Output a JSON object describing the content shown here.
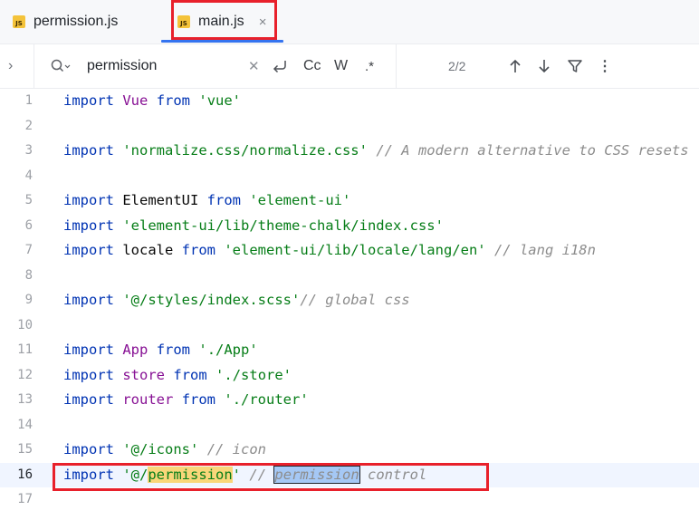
{
  "tabs": [
    {
      "label": "permission.js",
      "icon": "js-file-icon",
      "active": false
    },
    {
      "label": "main.js",
      "icon": "js-file-icon",
      "active": true,
      "close": "×"
    }
  ],
  "find": {
    "query": "permission",
    "match_count": "2/2",
    "case_label": "Cc",
    "word_label": "W",
    "regex_label": ".*"
  },
  "editor": {
    "current_line": 16,
    "lines": [
      {
        "n": "1",
        "code": "import Vue from 'vue'"
      },
      {
        "n": "2",
        "code": ""
      },
      {
        "n": "3",
        "code": "import 'normalize.css/normalize.css' // A modern alternative to CSS resets"
      },
      {
        "n": "4",
        "code": ""
      },
      {
        "n": "5",
        "code": "import ElementUI from 'element-ui'"
      },
      {
        "n": "6",
        "code": "import 'element-ui/lib/theme-chalk/index.css'"
      },
      {
        "n": "7",
        "code": "import locale from 'element-ui/lib/locale/lang/en' // lang i18n"
      },
      {
        "n": "8",
        "code": ""
      },
      {
        "n": "9",
        "code": "import '@/styles/index.scss'// global css"
      },
      {
        "n": "10",
        "code": ""
      },
      {
        "n": "11",
        "code": "import App from './App'"
      },
      {
        "n": "12",
        "code": "import store from './store'"
      },
      {
        "n": "13",
        "code": "import router from './router'"
      },
      {
        "n": "14",
        "code": ""
      },
      {
        "n": "15",
        "code": "import '@/icons' // icon"
      },
      {
        "n": "16",
        "code": "import '@/permission' // permission control"
      },
      {
        "n": "17",
        "code": ""
      }
    ]
  },
  "colors": {
    "keyword": "#0033b3",
    "string": "#067d17",
    "comment": "#8c8c8c",
    "identifier": "#871094",
    "match_highlight": "#f9d67a",
    "current_match": "#a5c8f5",
    "annotation_box": "#e8202b",
    "active_tab_underline": "#3574f0"
  }
}
